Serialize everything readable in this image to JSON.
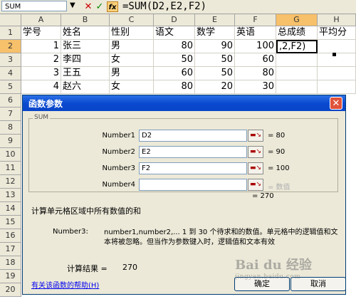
{
  "formula_bar": {
    "name_box": "SUM",
    "cancel": "✕",
    "enter": "✓",
    "fx": "fx",
    "formula": "=SUM(D2,E2,F2)"
  },
  "grid": {
    "columns": [
      "A",
      "B",
      "C",
      "D",
      "E",
      "F",
      "G",
      "H"
    ],
    "rows": [
      "1",
      "2",
      "3",
      "4",
      "5",
      "6",
      "7",
      "8",
      "9",
      "10",
      "11",
      "12",
      "13",
      "14",
      "15",
      "16",
      "17",
      "18",
      "19",
      "20"
    ],
    "headers": [
      "学号",
      "姓名",
      "性别",
      "语文",
      "数学",
      "英语",
      "总成绩",
      "平均分"
    ],
    "data": [
      {
        "id": "1",
        "name": "张三",
        "gender": "男",
        "chinese": "80",
        "math": "90",
        "english": "100",
        "total": ",2,F2)"
      },
      {
        "id": "2",
        "name": "李四",
        "gender": "女",
        "chinese": "50",
        "math": "50",
        "english": "60",
        "total": ""
      },
      {
        "id": "3",
        "name": "王五",
        "gender": "男",
        "chinese": "60",
        "math": "50",
        "english": "80",
        "total": ""
      },
      {
        "id": "4",
        "name": "赵六",
        "gender": "女",
        "chinese": "80",
        "math": "20",
        "english": "30",
        "total": ""
      }
    ]
  },
  "dialog": {
    "title": "函数参数",
    "close": "✕",
    "group_label": "SUM",
    "args": [
      {
        "label": "Number1",
        "value": "D2",
        "result": "= 80"
      },
      {
        "label": "Number2",
        "value": "E2",
        "result": "= 90"
      },
      {
        "label": "Number3",
        "value": "F2",
        "result": "= 100"
      },
      {
        "label": "Number4",
        "value": "",
        "result": "= 数值"
      }
    ],
    "total": "= 270",
    "description": "计算单元格区域中所有数值的和",
    "arg_desc_name": "Number3:",
    "arg_desc_text": "number1,number2,... 1 到 30 个待求和的数值。单元格中的逻辑值和文本将被忽略。但当作为参数键入时，逻辑值和文本有效",
    "calc_label": "计算结果 =",
    "calc_value": "270",
    "help_link": "有关该函数的帮助(H)",
    "ok": "确定",
    "cancel": "取消"
  },
  "watermark": {
    "brand": "Bai du 经验",
    "url": "jingyan.baidu.com"
  }
}
